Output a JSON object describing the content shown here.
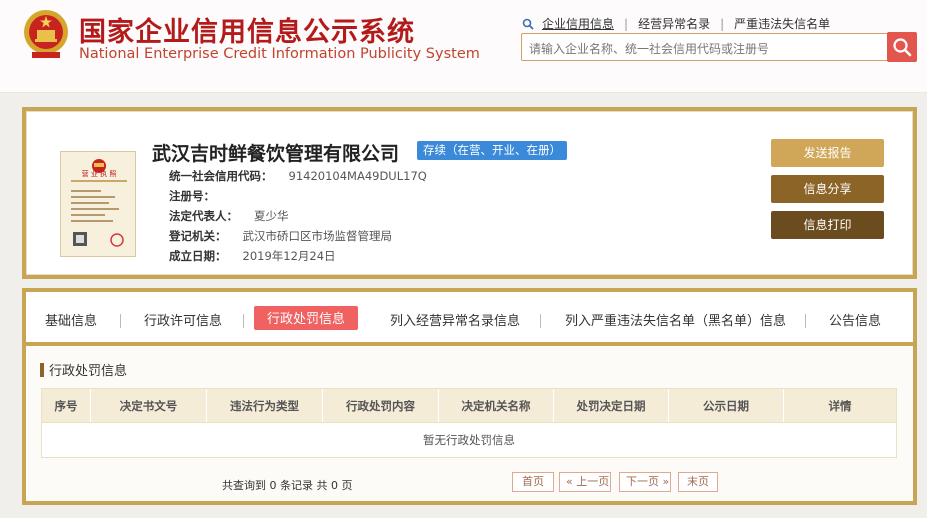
{
  "header": {
    "title_cn": "国家企业信用信息公示系统",
    "title_en": "National Enterprise Credit Information Publicity System",
    "links": [
      "企业信用信息",
      "经营异常名录",
      "严重违法失信名单"
    ],
    "search_placeholder": "请输入企业名称、统一社会信用代码或注册号"
  },
  "company": {
    "name": "武汉吉时鲜餐饮管理有限公司",
    "status": "存续（在营、开业、在册）",
    "fields": [
      {
        "label": "统一社会信用代码：",
        "value": "91420104MA49DUL17Q"
      },
      {
        "label": "注册号：",
        "value": ""
      },
      {
        "label": "法定代表人：",
        "value": "夏少华"
      },
      {
        "label": "登记机关：",
        "value": "武汉市硚口区市场监督管理局"
      },
      {
        "label": "成立日期：",
        "value": "2019年12月24日"
      }
    ],
    "license_label": "营 业 执 照",
    "buttons": {
      "send": "发送报告",
      "share": "信息分享",
      "print": "信息打印"
    }
  },
  "tabs": [
    "基础信息",
    "行政许可信息",
    "行政处罚信息",
    "列入经营异常名录信息",
    "列入严重违法失信名单（黑名单）信息",
    "公告信息"
  ],
  "active_tab": "行政处罚信息",
  "section": {
    "title": "行政处罚信息",
    "columns": [
      "序号",
      "决定书文号",
      "违法行为类型",
      "行政处罚内容",
      "决定机关名称",
      "处罚决定日期",
      "公示日期",
      "详情"
    ],
    "empty_text": "暂无行政处罚信息"
  },
  "pager": {
    "summary": "共查询到 0 条记录 共 0 页",
    "first": "首页",
    "prev": "« 上一页",
    "next": "下一页 »",
    "last": "末页"
  },
  "colors": {
    "accent_gold": "#c7a554",
    "brand_red": "#b31b1b",
    "active_tab": "#f06262",
    "status_blue": "#3b8ad9"
  }
}
